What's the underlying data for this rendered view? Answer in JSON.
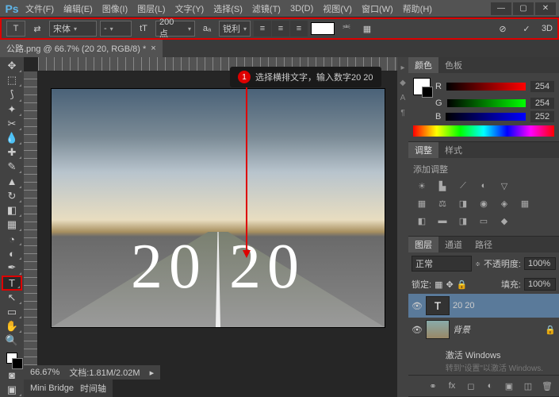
{
  "app": {
    "logo": "Ps"
  },
  "menu": [
    "文件(F)",
    "编辑(E)",
    "图像(I)",
    "图层(L)",
    "文字(Y)",
    "选择(S)",
    "滤镜(T)",
    "3D(D)",
    "视图(V)",
    "窗口(W)",
    "帮助(H)"
  ],
  "options": {
    "font": "宋体",
    "style": "-",
    "size": "200 点",
    "aa": "锐利",
    "three_d_btn": "3D"
  },
  "doc_tab": "公路.png @ 66.7% (20 20, RGB/8) *",
  "annotation": {
    "num": "1",
    "text": "选择横排文字，输入数字20 20"
  },
  "canvas_text": "20 20",
  "panels": {
    "color_tab": "颜色",
    "swatch_tab": "色板",
    "color": {
      "r": "254",
      "g": "254",
      "b": "252",
      "r_label": "R",
      "g_label": "G",
      "b_label": "B"
    },
    "adjust_tab": "调整",
    "style_tab": "样式",
    "adjust_title": "添加调整",
    "layers_tab": "图层",
    "channels_tab": "通道",
    "paths_tab": "路径",
    "blend_mode": "正常",
    "opacity_label": "不透明度:",
    "opacity": "100%",
    "lock_label": "锁定:",
    "fill_label": "填充:",
    "fill": "100%",
    "layers": [
      {
        "name": "20 20",
        "type": "text"
      },
      {
        "name": "背景",
        "type": "img"
      }
    ]
  },
  "status": {
    "zoom": "66.67%",
    "doc_info": "文档:1.81M/2.02M"
  },
  "mini_bridge": {
    "tab1": "Mini Bridge",
    "tab2": "时间轴"
  },
  "watermark": {
    "title": "激活 Windows",
    "sub": "转到\"设置\"以激活 Windows."
  }
}
